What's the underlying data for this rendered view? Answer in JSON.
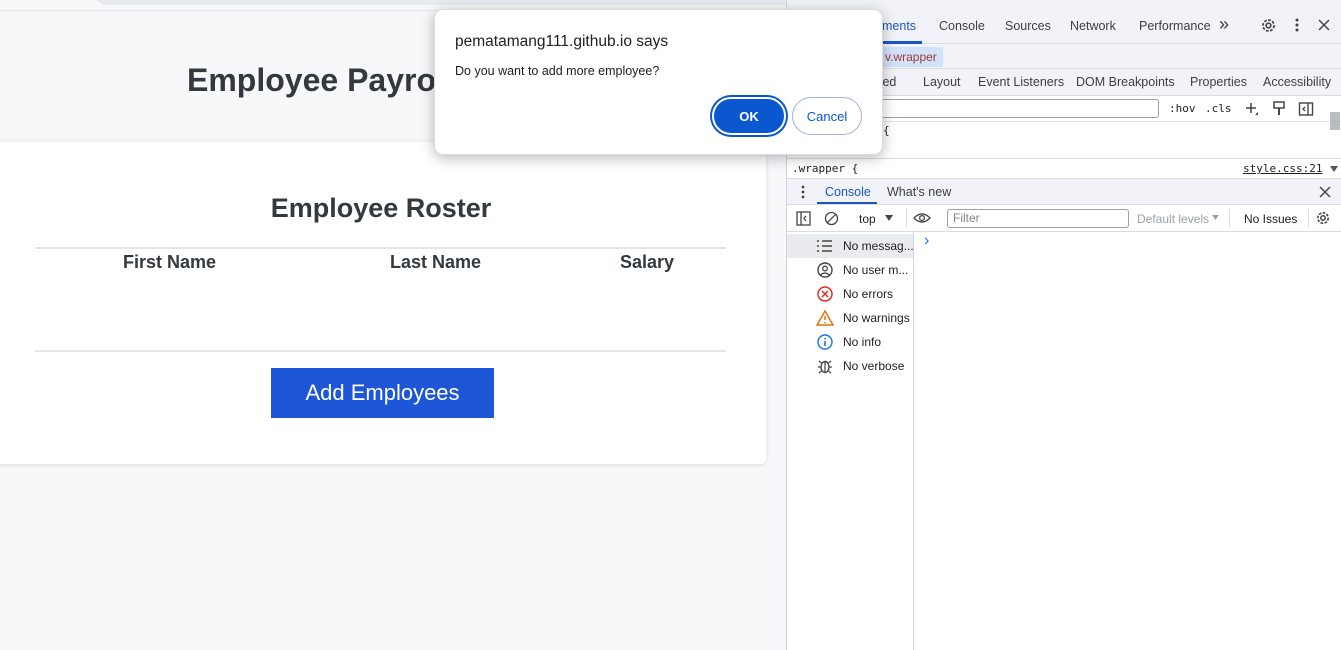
{
  "page": {
    "title": "Employee Payroll",
    "card_title": "Employee Roster",
    "columns": [
      "First Name",
      "Last Name",
      "Salary"
    ],
    "add_button": "Add Employees"
  },
  "dialog": {
    "title": "pematamang111.github.io says",
    "message": "Do you want to add more employee?",
    "ok": "OK",
    "cancel": "Cancel"
  },
  "devtools": {
    "tabs": [
      "ments",
      "Console",
      "Sources",
      "Network",
      "Performance"
    ],
    "more_tabs_glyph": "»",
    "breadcrumb": "v.wrapper",
    "sub_tabs": [
      "ted",
      "Layout",
      "Event Listeners",
      "DOM Breakpoints",
      "Properties",
      "Accessibility"
    ],
    "style_filter": {
      "hov": ":hov",
      "cls": ".cls"
    },
    "rule_brace": "{",
    "rule_selector": ".wrapper {",
    "rule_source": "style.css:21",
    "drawer_tabs": {
      "active": "Console",
      "other": "What's new"
    },
    "console_toolbar": {
      "context": "top",
      "filter_placeholder": "Filter",
      "levels": "Default levels",
      "issues": "No Issues"
    },
    "sidebar": [
      {
        "icon": "list-icon",
        "label": "No messag..."
      },
      {
        "icon": "user-icon",
        "label": "No user m..."
      },
      {
        "icon": "error-icon",
        "label": "No errors"
      },
      {
        "icon": "warning-icon",
        "label": "No warnings"
      },
      {
        "icon": "info-icon",
        "label": "No info"
      },
      {
        "icon": "bug-icon",
        "label": "No verbose"
      }
    ],
    "prompt_glyph": "›",
    "colors": {
      "accent": "#1a56c4",
      "error": "#d93025",
      "warning": "#e8710a",
      "info": "#1a73e8"
    }
  }
}
